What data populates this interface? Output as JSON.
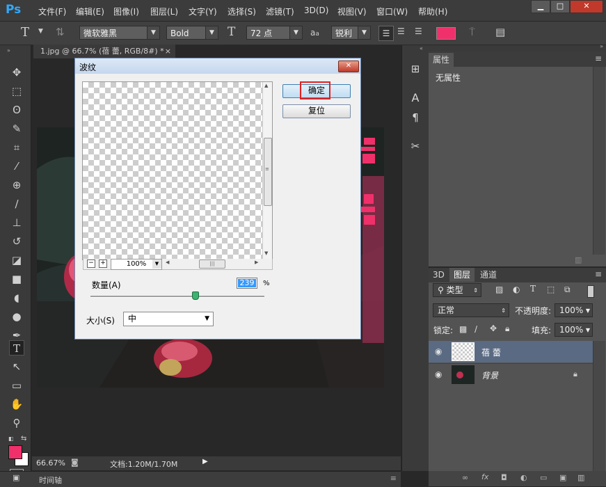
{
  "app": {
    "logo": "Ps"
  },
  "menu": [
    "文件(F)",
    "编辑(E)",
    "图像(I)",
    "图层(L)",
    "文字(Y)",
    "选择(S)",
    "滤镜(T)",
    "3D(D)",
    "视图(V)",
    "窗口(W)",
    "帮助(H)"
  ],
  "options": {
    "font_family": "微软雅黑",
    "font_style": "Bold",
    "font_size": "72 点",
    "aa_label": "a",
    "aa_small": "a",
    "antialias": "锐利",
    "text_color": "#f0306a"
  },
  "document": {
    "tab_title": "1.jpg @ 66.7% (蓓 蕾, RGB/8#) *",
    "tab_close": "×",
    "zoom": "66.67%",
    "doc_info": "文档:1.20M/1.70M"
  },
  "timeline": {
    "label": "时间轴"
  },
  "dialog": {
    "title": "波纹",
    "ok_label": "确定",
    "reset_label": "复位",
    "preview_zoom": "100%",
    "amount_label": "数量(A)",
    "amount_value": "239",
    "amount_unit": "%",
    "amount_slider_level": 0.6,
    "size_label": "大小(S)",
    "size_value": "中"
  },
  "properties_panel": {
    "tab": "属性",
    "content": "无属性"
  },
  "layers_panel": {
    "tabs": [
      "3D",
      "图层",
      "通道"
    ],
    "filter_kind": "类型",
    "blend_mode": "正常",
    "opacity_label": "不透明度:",
    "opacity_value": "100%",
    "lock_label": "锁定:",
    "fill_label": "填充:",
    "fill_value": "100%",
    "layers": [
      {
        "name": "蓓 蕾",
        "selected": true
      },
      {
        "name": "背景",
        "selected": false
      }
    ]
  },
  "colors": {
    "accent_pink": "#f0306a",
    "highlight_box": "#e02020",
    "title_blue": "#3a6ea8"
  }
}
